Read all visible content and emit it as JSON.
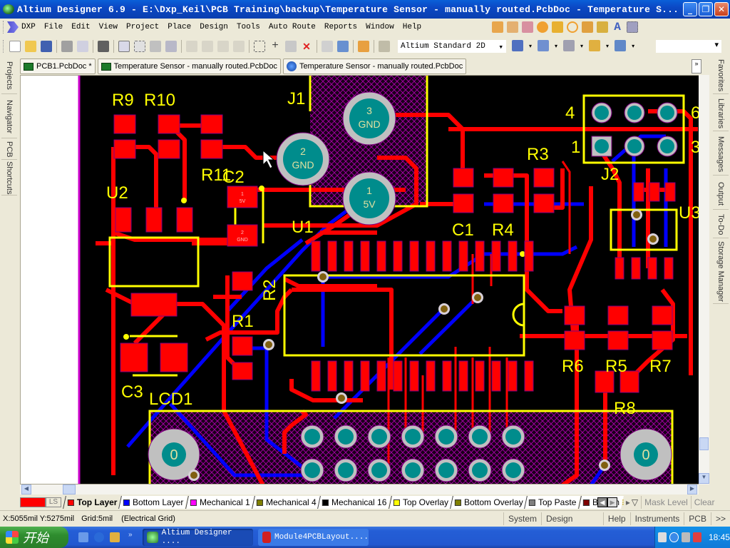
{
  "window": {
    "title": "Altium Designer 6.9 - E:\\Dxp_Keil\\PCB Training\\backup\\Temperature Sensor - manually routed.PcbDoc - Temperature S...",
    "controls": {
      "minimize": "_",
      "restore": "❐",
      "close": "✕"
    }
  },
  "menu": {
    "items": [
      {
        "label": "DXP"
      },
      {
        "label": "File"
      },
      {
        "label": "Edit"
      },
      {
        "label": "View"
      },
      {
        "label": "Project"
      },
      {
        "label": "Place"
      },
      {
        "label": "Design"
      },
      {
        "label": "Tools"
      },
      {
        "label": "Auto Route"
      },
      {
        "label": "Reports"
      },
      {
        "label": "Window"
      },
      {
        "label": "Help"
      }
    ],
    "place_tools": [
      "interactive-route-icon",
      "differential-route-icon",
      "multi-route-icon",
      "via-icon",
      "pad-icon",
      "arc-icon",
      "fill-icon",
      "polygon-icon",
      "string-icon",
      "component-icon"
    ]
  },
  "toolbar": {
    "view_mode": "Altium Standard 2D",
    "right_select": ""
  },
  "tabs": [
    {
      "label": "PCB1.PcbDoc *",
      "icon": "pcb-icon"
    },
    {
      "label": "Temperature Sensor - manually routed.PcbDoc",
      "icon": "pcb-icon"
    },
    {
      "label": "Temperature Sensor - manually routed.PcbDoc",
      "icon": "browser-icon"
    }
  ],
  "more_tabs": "»",
  "left_panels": [
    "Projects",
    "Navigator",
    "PCB",
    "Shortcuts"
  ],
  "right_panels": [
    "Favorites",
    "Libraries",
    "Messages",
    "Output",
    "To-Do",
    "Storage Manager"
  ],
  "pcb": {
    "colors": {
      "top": "#ff0000",
      "bottom": "#0000ff",
      "overlay": "#ffff00",
      "pad_ring": "#c0c0c0",
      "pad_hole": "#008c8c",
      "background": "#000000",
      "keepout": "#cc00cc"
    },
    "designators": [
      "R9",
      "R10",
      "J1",
      "R11",
      "C2",
      "U2",
      "U1",
      "C1",
      "R3",
      "R4",
      "J2",
      "U3",
      "R2",
      "R1",
      "C3",
      "LCD1",
      "R6",
      "R5",
      "R7",
      "R8"
    ],
    "j1_pads": [
      {
        "num": "3",
        "net": "GND"
      },
      {
        "num": "2",
        "net": "GND"
      },
      {
        "num": "1",
        "net": "5V"
      }
    ],
    "j2_pin_labels": [
      "4",
      "6",
      "1",
      "3"
    ],
    "lcd_mount_label": "0",
    "c2_pads": [
      {
        "num": "1",
        "net": "5V"
      },
      {
        "num": "2",
        "net": "GND"
      }
    ]
  },
  "layers": {
    "current_swatch": "#ff0000",
    "ls_label": "LS",
    "items": [
      {
        "label": "Top Layer",
        "color": "#ff0000",
        "active": true
      },
      {
        "label": "Bottom Layer",
        "color": "#0000ff"
      },
      {
        "label": "Mechanical 1",
        "color": "#ff00ff"
      },
      {
        "label": "Mechanical 4",
        "color": "#808000"
      },
      {
        "label": "Mechanical 16",
        "color": "#000000"
      },
      {
        "label": "Top Overlay",
        "color": "#ffff00"
      },
      {
        "label": "Bottom Overlay",
        "color": "#808000"
      },
      {
        "label": "Top Paste",
        "color": "#808080"
      },
      {
        "label": "Bottom",
        "color": "#800000"
      }
    ],
    "mask_level": "Mask Level",
    "clear": "Clear"
  },
  "status": {
    "coords": "X:5055mil Y:5275mil",
    "grid": "Grid:5mil",
    "grid_type": "(Electrical Grid)",
    "panels": [
      "System",
      "Design Compiler",
      "Help",
      "Instruments",
      "PCB",
      ">>"
    ]
  },
  "taskbar": {
    "start": "开始",
    "items": [
      {
        "label": "Altium Designer ....",
        "active": true
      },
      {
        "label": "Module4PCBLayout....",
        "active": false
      }
    ],
    "clock": "18:45"
  }
}
